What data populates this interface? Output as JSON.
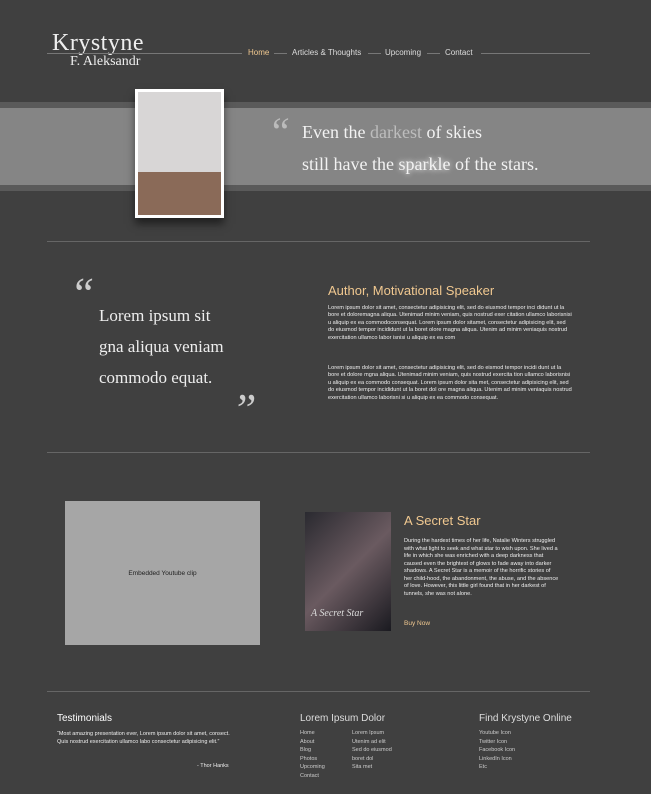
{
  "logo": {
    "line1": "Krystyne",
    "line2": "F. Aleksandr"
  },
  "nav": [
    {
      "label": "Home",
      "active": true
    },
    {
      "label": "Articles & Thoughts"
    },
    {
      "label": "Upcoming"
    },
    {
      "label": "Contact"
    }
  ],
  "hero": {
    "quote_line1": [
      "Even the ",
      "darkest",
      " of skies"
    ],
    "quote_line2": [
      "still have the ",
      "sparkle",
      " of the stars."
    ],
    "open_quote": "“"
  },
  "about": {
    "quote_lines": [
      "Lorem ipsum sit",
      "gna aliqua veniam",
      "commodo equat."
    ],
    "open_quote": "“",
    "close_quote": "”",
    "title": "Author, Motivational Speaker",
    "para1": "Lorem ipsum dolor sit amet, consectetur adipisicing elit, sed do eiusmod tempor inci didunt ut la bore et doloremagna aliqua. Utenimad minim veniam, quis nostrud exer citation ullamco laborisnisi u aliquip ex ea commodoconsequat.  Lorem ipsum dolor sitamet, consectetur adipisicing elit, sed do eiusmod tempor incididunt ut la boret olore magna aliqua. Utenim ad minim veniaquis nostrud exercitation ullamco labor isnisi u aliquip ex ea com",
    "para2": "Lorem ipsum dolor sit amet, consectetur adipisicing elit, sed do eismod tempor incidi dunt ut la bore et dolore mgna aliqua. Utenimad minim veniam, quis nostrud exercita tion ullamco laborisnisi u aliquip ex ea commodo consequat.  Lorem ipsum dolor sita met, consectetur adipisicing elit, sed do eiusmod tempor incididunt ut la boret dol ore magna aliqua. Utenim ad minim veniaquis nostrud exercitation ullamco laborisni si u aliquip ex ea commodo consequat."
  },
  "video": {
    "label": "Embedded Youtube clip"
  },
  "book": {
    "cover_title": "A Secret Star",
    "title": "A Secret Star",
    "desc": "During the hardest times of her life, Natalie Winters struggled with what light to seek and what star to wish upon. She lived a life in which she was enriched with a deep darkness that caused even the brightest of glows to fade away into darker shadows. A Secret Star is a memoir of the horrific stories of her child-hood, the abandonment, the abuse, and the absence of love. However, this little girl found that in her darkest of tunnels, she was not alone.",
    "buy": "Buy Now"
  },
  "footer": {
    "testimonials": {
      "title": "Testimonials",
      "quote": "“Most amazing presentation ever, Lorem ipsum dolor sit amet, consect. Quis nostrud exercitation ullamco labo consectetur adipisicing elit.”",
      "author": "- Thor Hanks"
    },
    "links": {
      "title": "Lorem Ipsum Dolor",
      "col1": [
        "Home",
        "About",
        "Blog",
        "Photos",
        "Upcoming",
        "Contact"
      ],
      "col2": [
        "Lorem Ipsum",
        "Utenim ad elit",
        "Sed do eiusmod",
        "boret dol",
        "Sita met"
      ]
    },
    "social": {
      "title": "Find Krystyne Online",
      "items": [
        "Youtube Icon",
        "Twitter Icon",
        "Facebook Icon",
        "LinkedIn Icon",
        "Etc"
      ]
    }
  },
  "colors": {
    "background": "#404040",
    "accent": "#f0c890",
    "band": "#858585"
  }
}
